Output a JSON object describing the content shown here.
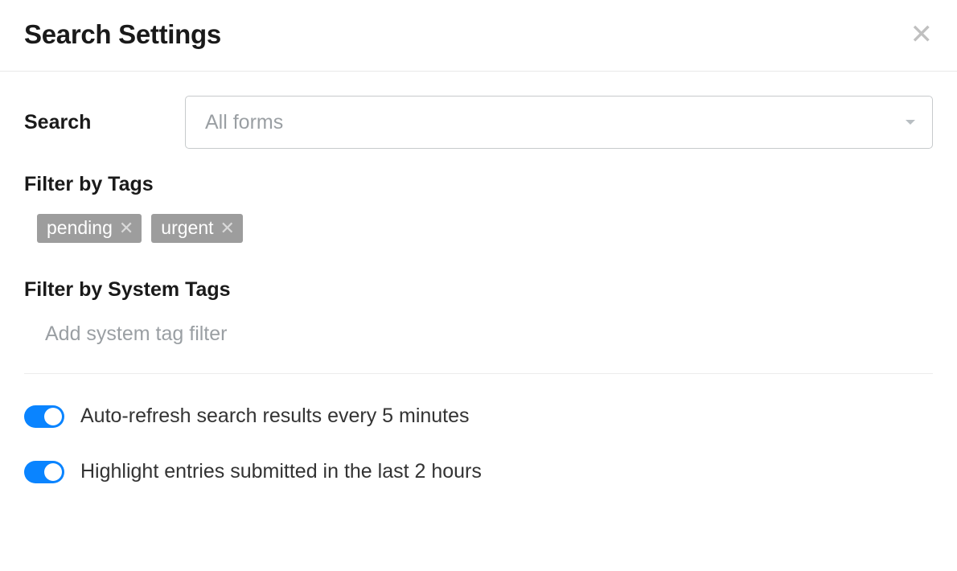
{
  "header": {
    "title": "Search Settings"
  },
  "search": {
    "label": "Search",
    "selected": "All forms"
  },
  "filterTags": {
    "label": "Filter by Tags",
    "tags": [
      "pending",
      "urgent"
    ]
  },
  "filterSystemTags": {
    "label": "Filter by System Tags",
    "placeholder": "Add system tag filter"
  },
  "toggles": {
    "autoRefresh": {
      "label": "Auto-refresh search results every 5 minutes",
      "on": true
    },
    "highlight": {
      "label": "Highlight entries submitted in the last 2 hours",
      "on": true
    }
  }
}
